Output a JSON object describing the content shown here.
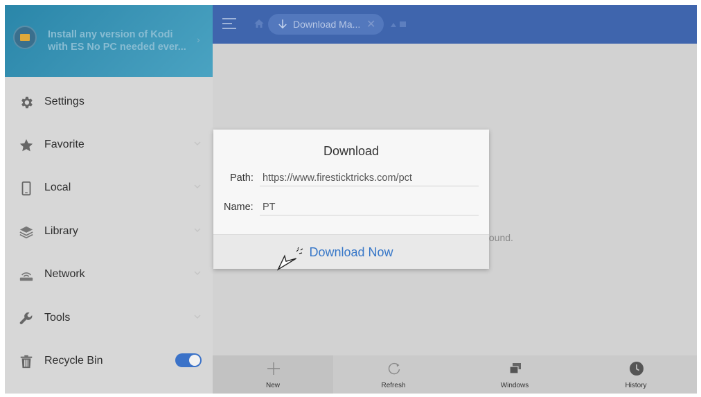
{
  "promo": {
    "text": "Install any version of Kodi with ES No PC needed ever..."
  },
  "topbar": {
    "tab_label": "Download Ma...",
    "tab_close": "✕"
  },
  "sidebar": {
    "items": [
      {
        "label": "Settings",
        "icon": "gear-icon",
        "expandable": false
      },
      {
        "label": "Favorite",
        "icon": "star-icon",
        "expandable": true
      },
      {
        "label": "Local",
        "icon": "phone-icon",
        "expandable": true
      },
      {
        "label": "Library",
        "icon": "layers-icon",
        "expandable": true
      },
      {
        "label": "Network",
        "icon": "network-icon",
        "expandable": true
      },
      {
        "label": "Tools",
        "icon": "wrench-icon",
        "expandable": true
      },
      {
        "label": "Recycle Bin",
        "icon": "trash-icon",
        "toggle": true
      }
    ]
  },
  "main": {
    "empty_text": "found."
  },
  "dialog": {
    "title": "Download",
    "path_label": "Path:",
    "path_value": "https://www.firesticktricks.com/pct",
    "name_label": "Name:",
    "name_value": "PT",
    "action_label": "Download Now"
  },
  "bottombar": {
    "items": [
      {
        "label": "New",
        "icon": "plus-icon"
      },
      {
        "label": "Refresh",
        "icon": "refresh-icon"
      },
      {
        "label": "Windows",
        "icon": "windows-icon"
      },
      {
        "label": "History",
        "icon": "clock-icon"
      }
    ]
  },
  "colors": {
    "accent_blue": "#3f65ad",
    "link_blue": "#3777c8",
    "toggle_on": "#3b72c8"
  }
}
